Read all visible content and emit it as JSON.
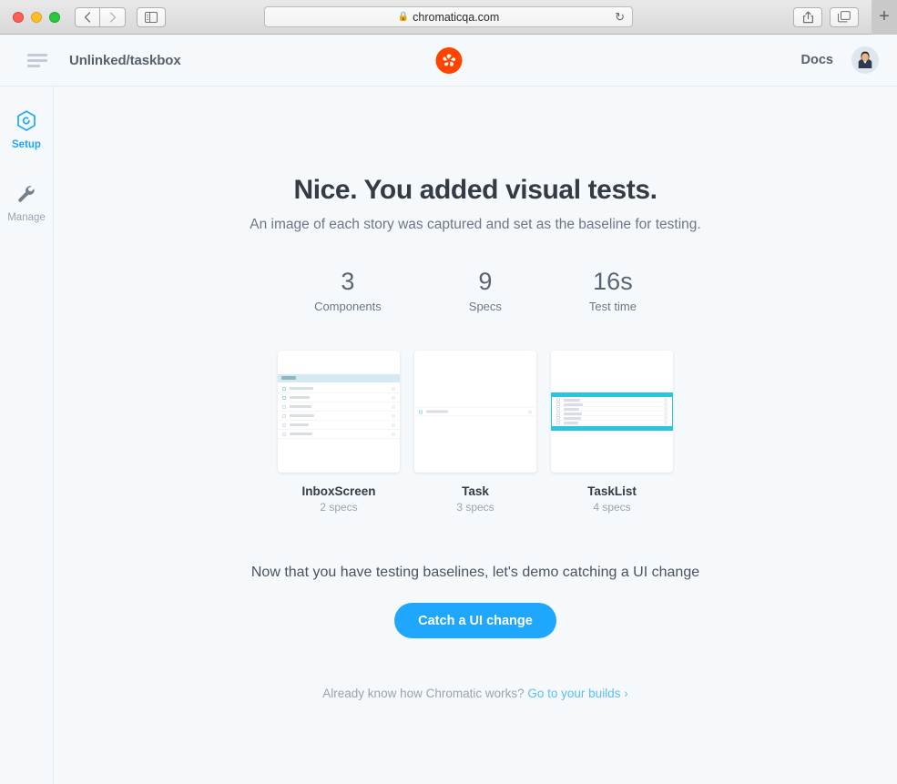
{
  "browser": {
    "url": "chromaticqa.com",
    "lock_icon": "lock-icon",
    "reload_icon": "reload-icon",
    "back_icon": "chevron-left-icon",
    "forward_icon": "chevron-right-icon",
    "sidebar_icon": "sidebar-toggle-icon",
    "share_icon": "share-icon",
    "tabs_icon": "tabs-overview-icon",
    "newtab_label": "+"
  },
  "header": {
    "menu_icon": "hamburger-menu-icon",
    "project_title": "Unlinked/taskbox",
    "logo_icon": "chromatic-logo-icon",
    "docs_label": "Docs",
    "avatar_icon": "user-avatar"
  },
  "sidenav": {
    "items": [
      {
        "label": "Setup",
        "icon": "hexagon-setup-icon",
        "active": true
      },
      {
        "label": "Manage",
        "icon": "wrench-manage-icon",
        "active": false
      }
    ]
  },
  "main": {
    "headline": "Nice. You added visual tests.",
    "subhead": "An image of each story was captured and set as the baseline for testing.",
    "stats": [
      {
        "value": "3",
        "label": "Components"
      },
      {
        "value": "9",
        "label": "Specs"
      },
      {
        "value": "16s",
        "label": "Test time"
      }
    ],
    "components": [
      {
        "name": "InboxScreen",
        "specs": "2 specs",
        "preview": "inbox"
      },
      {
        "name": "Task",
        "specs": "3 specs",
        "preview": "task"
      },
      {
        "name": "TaskList",
        "specs": "4 specs",
        "preview": "tasklist"
      }
    ],
    "cta_text": "Now that you have testing baselines, let's demo catching a UI change",
    "cta_button": "Catch a UI change",
    "footer_prefix": "Already know how Chromatic works?",
    "footer_link": "Go to your builds ›"
  },
  "colors": {
    "accent_blue": "#1ea7fd",
    "link_blue": "#5bbdf9",
    "brand_orange": "#ff4400",
    "highlight_cyan": "#29c5de",
    "page_bg": "#f6f9fc"
  }
}
